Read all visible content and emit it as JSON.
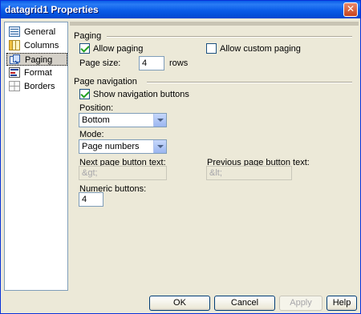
{
  "window": {
    "title": "datagrid1 Properties",
    "close_glyph": "✕"
  },
  "sidebar": {
    "items": [
      {
        "label": "General",
        "icon": "general-icon"
      },
      {
        "label": "Columns",
        "icon": "columns-icon"
      },
      {
        "label": "Paging",
        "icon": "paging-icon",
        "selected": true
      },
      {
        "label": "Format",
        "icon": "format-icon"
      },
      {
        "label": "Borders",
        "icon": "borders-icon"
      }
    ]
  },
  "paging": {
    "section_label": "Paging",
    "allow_paging_label": "Allow paging",
    "allow_paging_checked": true,
    "allow_custom_paging_label": "Allow custom paging",
    "allow_custom_paging_checked": false,
    "page_size_label": "Page size:",
    "page_size_value": "4",
    "page_size_unit": "rows"
  },
  "navigation": {
    "section_label": "Page navigation",
    "show_nav_buttons_label": "Show navigation buttons",
    "show_nav_buttons_checked": true,
    "position_label": "Position:",
    "position_value": "Bottom",
    "mode_label": "Mode:",
    "mode_value": "Page numbers",
    "next_text_label": "Next page button text:",
    "next_text_value": "&gt;",
    "prev_text_label": "Previous page button text:",
    "prev_text_value": "&lt;",
    "numeric_buttons_label": "Numeric buttons:",
    "numeric_buttons_value": "4"
  },
  "buttons": {
    "ok": "OK",
    "cancel": "Cancel",
    "apply": "Apply",
    "help": "Help"
  }
}
